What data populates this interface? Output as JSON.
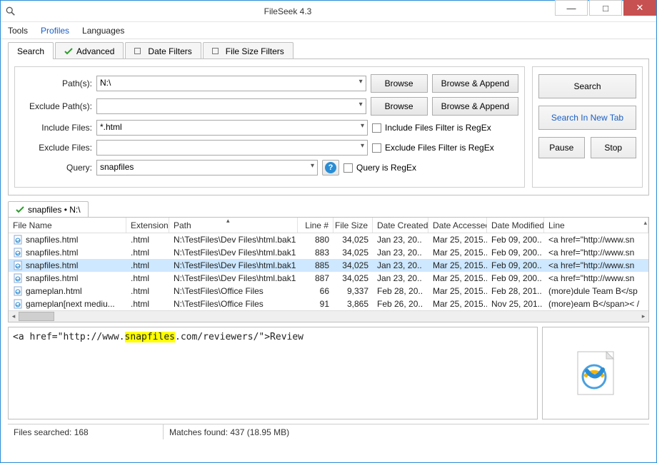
{
  "window": {
    "title": "FileSeek 4.3"
  },
  "menubar": [
    "Tools",
    "Profiles",
    "Languages"
  ],
  "tabs": [
    {
      "label": "Search",
      "icon": "",
      "active": true
    },
    {
      "label": "Advanced",
      "icon": "check",
      "active": false
    },
    {
      "label": "Date Filters",
      "icon": "square",
      "active": false
    },
    {
      "label": "File Size Filters",
      "icon": "square",
      "active": false
    }
  ],
  "form": {
    "paths_label": "Path(s):",
    "paths_value": "N:\\",
    "exclude_paths_label": "Exclude Path(s):",
    "exclude_paths_value": "",
    "include_files_label": "Include Files:",
    "include_files_value": "*.html",
    "exclude_files_label": "Exclude Files:",
    "exclude_files_value": "",
    "query_label": "Query:",
    "query_value": "snapfiles",
    "browse": "Browse",
    "browse_append": "Browse & Append",
    "include_regex": "Include Files Filter is RegEx",
    "exclude_regex": "Exclude Files Filter is RegEx",
    "query_regex": "Query is RegEx"
  },
  "side": {
    "search": "Search",
    "new_tab": "Search In New Tab",
    "pause": "Pause",
    "stop": "Stop"
  },
  "result_tab": "snapfiles • N:\\",
  "columns": [
    "File Name",
    "Extension",
    "Path",
    "Line #",
    "File Size",
    "Date Created",
    "Date Accessed",
    "Date Modified",
    "Line"
  ],
  "rows": [
    {
      "fn": "snapfiles.html",
      "ext": ".html",
      "path": "N:\\TestFiles\\Dev Files\\html.bak1",
      "ln": "880",
      "sz": "34,025",
      "dc": "Jan 23, 20..",
      "da": "Mar 25, 2015..",
      "dm": "Feb 09, 200..",
      "line": "<a href=\"http://www.sn",
      "sel": false
    },
    {
      "fn": "snapfiles.html",
      "ext": ".html",
      "path": "N:\\TestFiles\\Dev Files\\html.bak1",
      "ln": "883",
      "sz": "34,025",
      "dc": "Jan 23, 20..",
      "da": "Mar 25, 2015..",
      "dm": "Feb 09, 200..",
      "line": "<a href=\"http://www.sn",
      "sel": false
    },
    {
      "fn": "snapfiles.html",
      "ext": ".html",
      "path": "N:\\TestFiles\\Dev Files\\html.bak1",
      "ln": "885",
      "sz": "34,025",
      "dc": "Jan 23, 20..",
      "da": "Mar 25, 2015..",
      "dm": "Feb 09, 200..",
      "line": "<a href=\"http://www.sn",
      "sel": true
    },
    {
      "fn": "snapfiles.html",
      "ext": ".html",
      "path": "N:\\TestFiles\\Dev Files\\html.bak1",
      "ln": "887",
      "sz": "34,025",
      "dc": "Jan 23, 20..",
      "da": "Mar 25, 2015..",
      "dm": "Feb 09, 200..",
      "line": "<a href=\"http://www.sn",
      "sel": false
    },
    {
      "fn": "gameplan.html",
      "ext": ".html",
      "path": "N:\\TestFiles\\Office Files",
      "ln": "66",
      "sz": "9,337",
      "dc": "Feb 28, 20..",
      "da": "Mar 25, 2015..",
      "dm": "Feb 28, 201..",
      "line": "(more)dule Team B</sp",
      "sel": false
    },
    {
      "fn": "gameplan[next mediu...",
      "ext": ".html",
      "path": "N:\\TestFiles\\Office Files",
      "ln": "91",
      "sz": "3,865",
      "dc": "Feb 26, 20..",
      "da": "Mar 25, 2015..",
      "dm": "Nov 25, 201..",
      "line": "(more)eam B</span>< /",
      "sel": false
    }
  ],
  "preview": {
    "pre": "<a href=\"http://www.",
    "match": "snapfiles",
    "post": ".com/reviewers/\">Review"
  },
  "status": {
    "files": "Files searched: 168",
    "matches": "Matches found: 437 (18.95 MB)"
  }
}
